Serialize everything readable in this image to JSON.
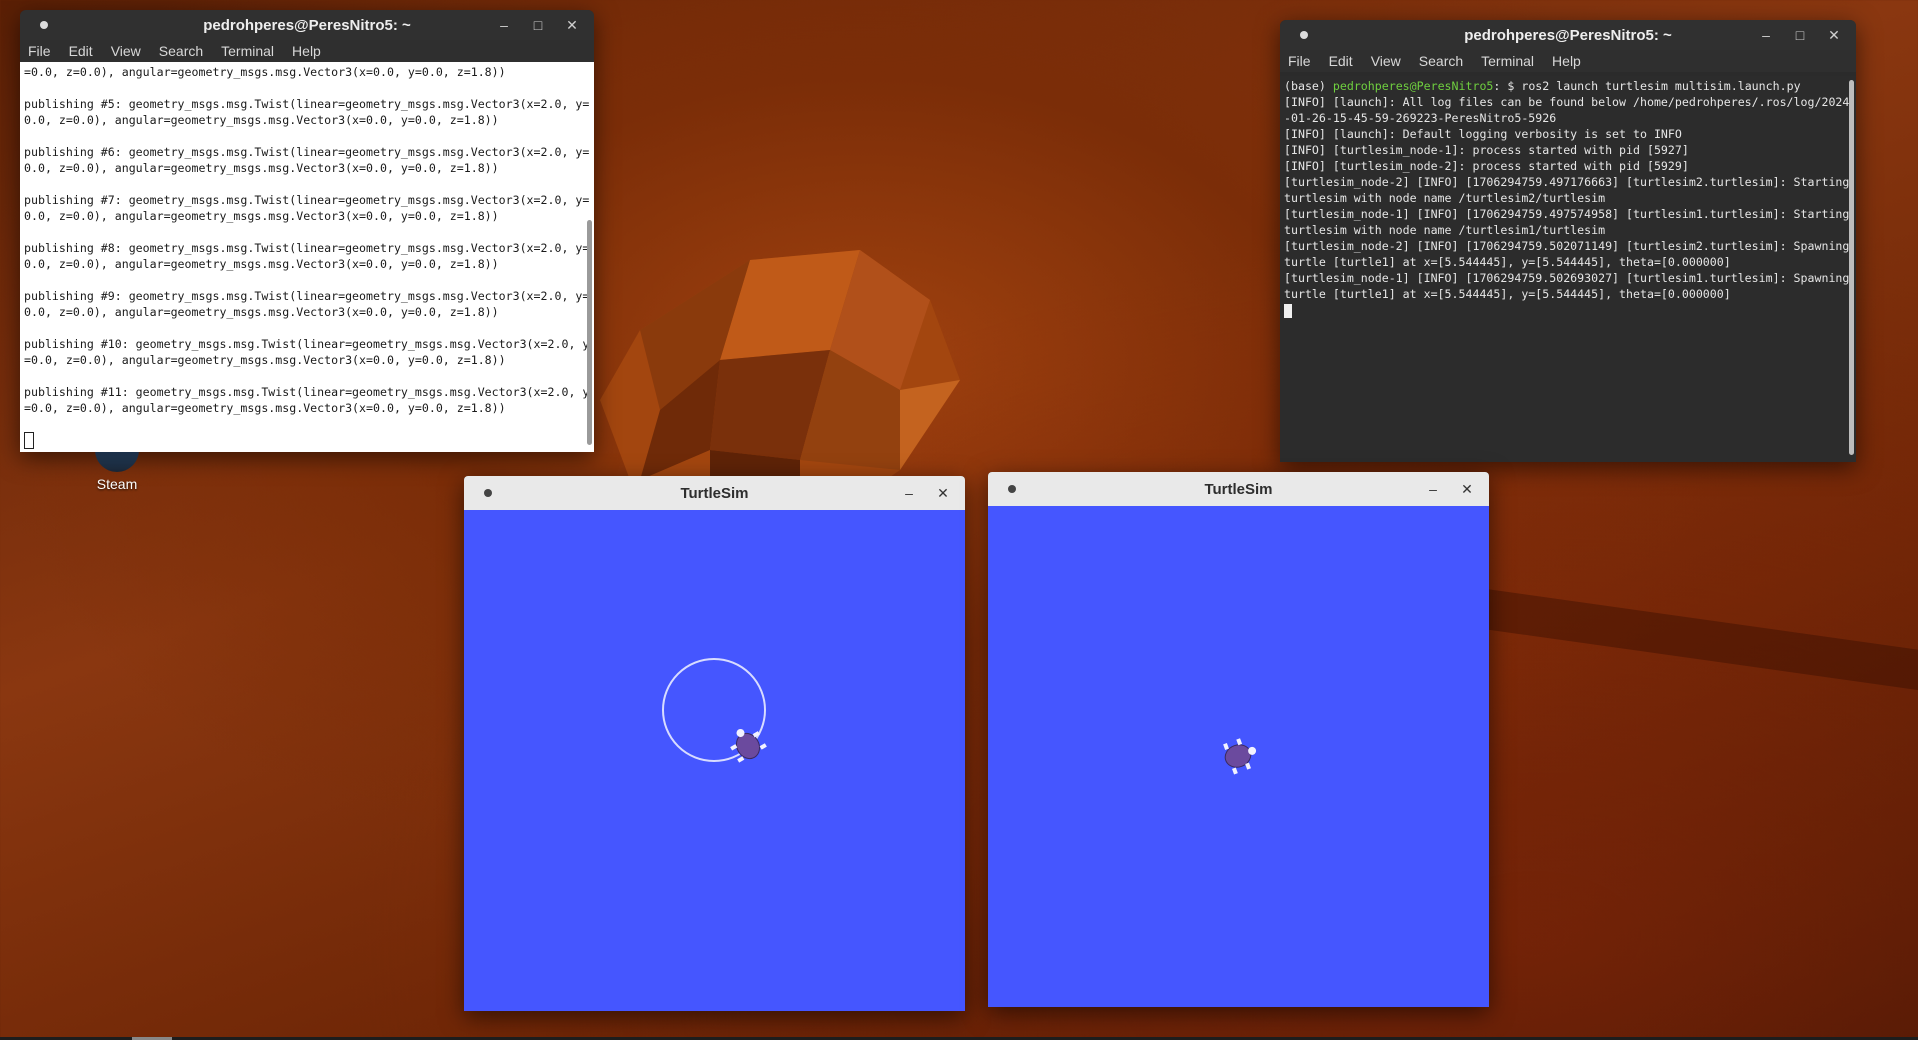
{
  "desktop": {
    "icons": [
      {
        "label": "Steam",
        "icon": "steam-icon"
      }
    ]
  },
  "terminal_left": {
    "title": "pedrohperes@PeresNitro5: ~",
    "menu": [
      "File",
      "Edit",
      "View",
      "Search",
      "Terminal",
      "Help"
    ],
    "lines": [
      "=0.0, z=0.0), angular=geometry_msgs.msg.Vector3(x=0.0, y=0.0, z=1.8))",
      "",
      "publishing #5: geometry_msgs.msg.Twist(linear=geometry_msgs.msg.Vector3(x=2.0, y=0.0, z=0.0), angular=geometry_msgs.msg.Vector3(x=0.0, y=0.0, z=1.8))",
      "",
      "publishing #6: geometry_msgs.msg.Twist(linear=geometry_msgs.msg.Vector3(x=2.0, y=0.0, z=0.0), angular=geometry_msgs.msg.Vector3(x=0.0, y=0.0, z=1.8))",
      "",
      "publishing #7: geometry_msgs.msg.Twist(linear=geometry_msgs.msg.Vector3(x=2.0, y=0.0, z=0.0), angular=geometry_msgs.msg.Vector3(x=0.0, y=0.0, z=1.8))",
      "",
      "publishing #8: geometry_msgs.msg.Twist(linear=geometry_msgs.msg.Vector3(x=2.0, y=0.0, z=0.0), angular=geometry_msgs.msg.Vector3(x=0.0, y=0.0, z=1.8))",
      "",
      "publishing #9: geometry_msgs.msg.Twist(linear=geometry_msgs.msg.Vector3(x=2.0, y=0.0, z=0.0), angular=geometry_msgs.msg.Vector3(x=0.0, y=0.0, z=1.8))",
      "",
      "publishing #10: geometry_msgs.msg.Twist(linear=geometry_msgs.msg.Vector3(x=2.0, y=0.0, z=0.0), angular=geometry_msgs.msg.Vector3(x=0.0, y=0.0, z=1.8))",
      "",
      "publishing #11: geometry_msgs.msg.Twist(linear=geometry_msgs.msg.Vector3(x=2.0, y=0.0, z=0.0), angular=geometry_msgs.msg.Vector3(x=0.0, y=0.0, z=1.8))",
      ""
    ]
  },
  "terminal_right": {
    "title": "pedrohperes@PeresNitro5: ~",
    "menu": [
      "File",
      "Edit",
      "View",
      "Search",
      "Terminal",
      "Help"
    ],
    "prompt_env": "(base) ",
    "prompt_user": "pedrohperes@PeresNitro5",
    "prompt_rest": ": $ ros2 launch turtlesim multisim.launch.py",
    "lines": [
      "[INFO] [launch]: All log files can be found below /home/pedrohperes/.ros/log/2024-01-26-15-45-59-269223-PeresNitro5-5926",
      "[INFO] [launch]: Default logging verbosity is set to INFO",
      "[INFO] [turtlesim_node-1]: process started with pid [5927]",
      "[INFO] [turtlesim_node-2]: process started with pid [5929]",
      "[turtlesim_node-2] [INFO] [1706294759.497176663] [turtlesim2.turtlesim]: Starting turtlesim with node name /turtlesim2/turtlesim",
      "[turtlesim_node-1] [INFO] [1706294759.497574958] [turtlesim1.turtlesim]: Starting turtlesim with node name /turtlesim1/turtlesim",
      "[turtlesim_node-2] [INFO] [1706294759.502071149] [turtlesim2.turtlesim]: Spawning turtle [turtle1] at x=[5.544445], y=[5.544445], theta=[0.000000]",
      "[turtlesim_node-1] [INFO] [1706294759.502693027] [turtlesim1.turtlesim]: Spawning turtle [turtle1] at x=[5.544445], y=[5.544445], theta=[0.000000]"
    ]
  },
  "turtlesim_1": {
    "title": "TurtleSim"
  },
  "turtlesim_2": {
    "title": "TurtleSim"
  },
  "window_controls": {
    "minimize": "–",
    "maximize": "□",
    "close": "✕"
  },
  "colors": {
    "turtlesim_bg": "#4556ff",
    "prompt_green": "#6fcf3f"
  }
}
